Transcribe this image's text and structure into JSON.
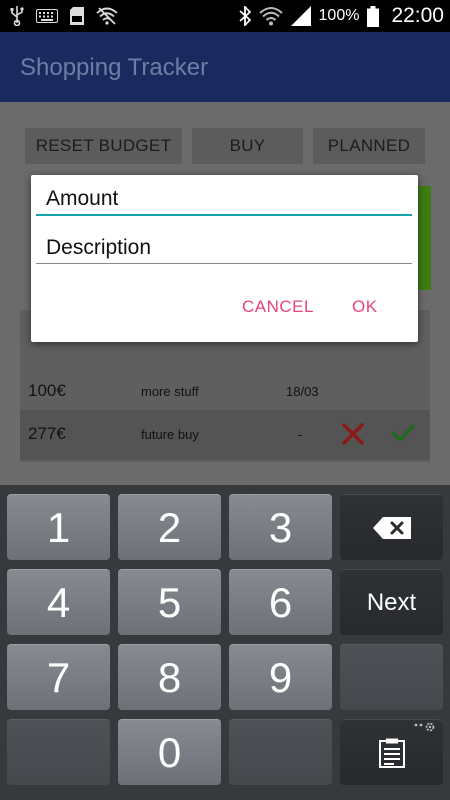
{
  "status_bar": {
    "left_icons": [
      "usb-icon",
      "keyboard-icon",
      "sd-card-icon",
      "wifi-off-icon"
    ],
    "right_icons": [
      "bluetooth-icon",
      "wifi-icon",
      "signal-icon",
      "battery-icon"
    ],
    "battery": "100%",
    "time": "22:00"
  },
  "app": {
    "title": "Shopping Tracker"
  },
  "toolbar": {
    "reset_label": "RESET BUDGET",
    "buy_label": "BUY",
    "planned_label": "PLANNED"
  },
  "list": {
    "rows": [
      {
        "amount": "100€",
        "description": "more stuff",
        "date": "18/03"
      },
      {
        "amount": "277€",
        "description": "future buy",
        "date": "-"
      }
    ]
  },
  "dialog": {
    "amount_placeholder": "Amount",
    "description_placeholder": "Description",
    "cancel_label": "CANCEL",
    "ok_label": "OK"
  },
  "keyboard": {
    "keys": [
      "1",
      "2",
      "3",
      "4",
      "5",
      "6",
      "7",
      "8",
      "9",
      "0"
    ],
    "next_label": "Next"
  },
  "colors": {
    "accent": "#e8447e",
    "input_focus": "#17a2a6",
    "action_bar": "#1b2a5e",
    "cancel_red": "#b0201a",
    "confirm_green": "#2a8a2a"
  }
}
